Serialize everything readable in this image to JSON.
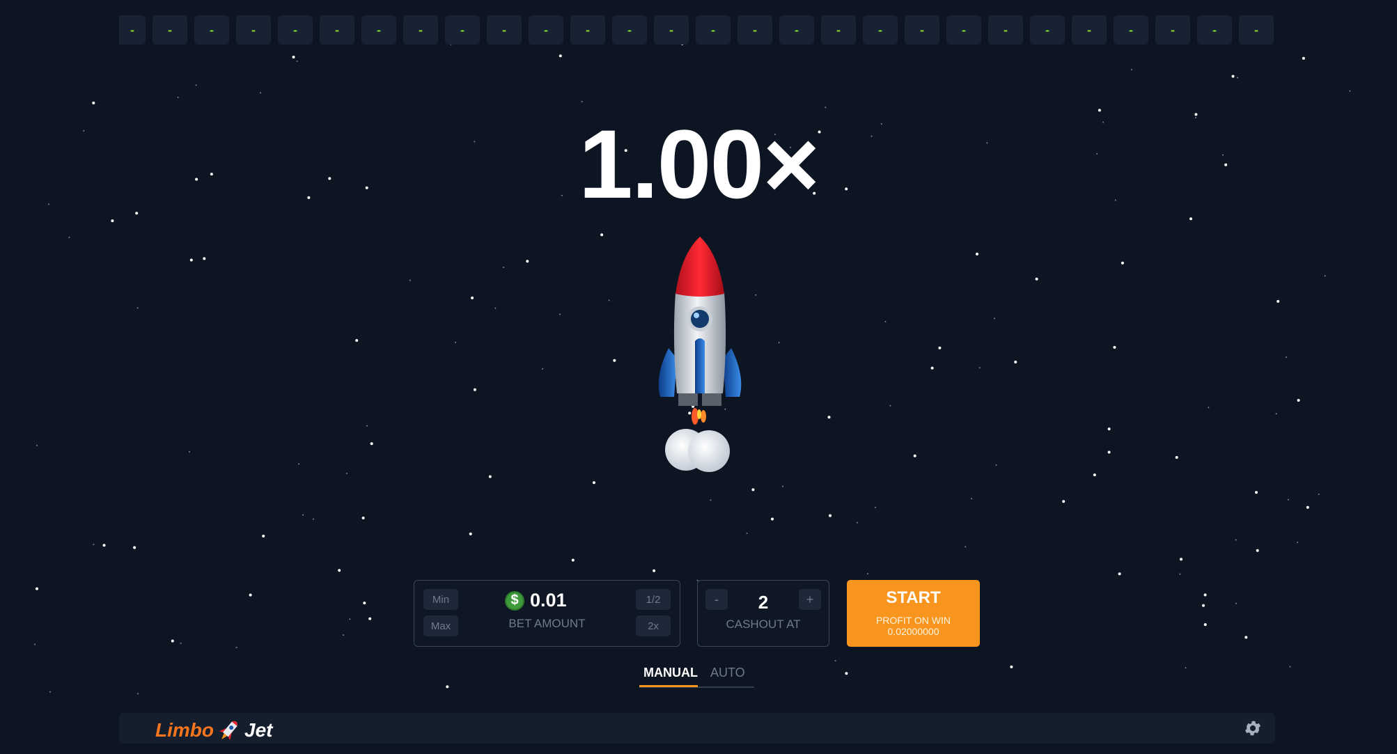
{
  "history": [
    "-",
    "-",
    "-",
    "-",
    "-",
    "-",
    "-",
    "-",
    "-",
    "-",
    "-",
    "-",
    "-",
    "-",
    "-",
    "-",
    "-",
    "-",
    "-",
    "-",
    "-",
    "-",
    "-",
    "-",
    "-",
    "-",
    "-",
    "-"
  ],
  "game": {
    "multiplier": "1.00×"
  },
  "bet": {
    "min_label": "Min",
    "max_label": "Max",
    "half_label": "1/2",
    "double_label": "2x",
    "currency_symbol": "$",
    "amount": "0.01",
    "label": "BET AMOUNT"
  },
  "cashout": {
    "minus_label": "-",
    "plus_label": "+",
    "value": "2",
    "label": "CASHOUT AT"
  },
  "start": {
    "label": "START",
    "profit_label": "PROFIT ON WIN",
    "profit_value": "0.02000000"
  },
  "tabs": {
    "manual": "MANUAL",
    "auto": "AUTO"
  },
  "footer": {
    "logo_left": "Limbo",
    "logo_right": "Jet"
  },
  "colors": {
    "accent": "#f7951e",
    "history_text": "#7fd12a",
    "background": "#0e1522"
  }
}
